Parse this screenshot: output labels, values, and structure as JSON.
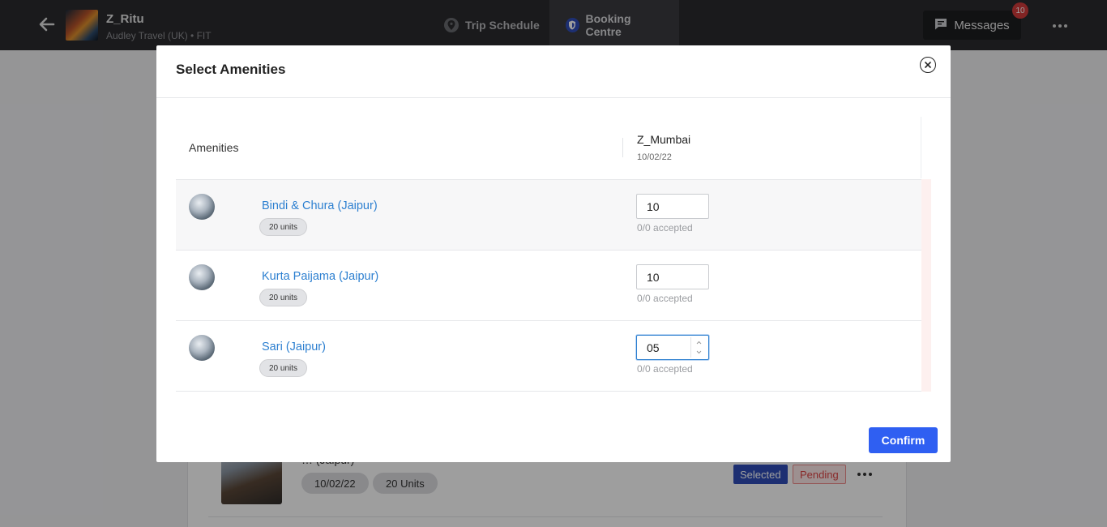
{
  "topbar": {
    "trip_title": "Z_Ritu",
    "trip_subtitle": "Audley Travel (UK) • FIT",
    "tabs": [
      {
        "label": "Trip Schedule",
        "icon": "location-pin-icon"
      },
      {
        "label": "Booking Centre",
        "icon": "shield-icon"
      }
    ],
    "messages_label": "Messages",
    "messages_count": "10"
  },
  "background_card": {
    "title": "… (Jaipur)",
    "date": "10/02/22",
    "units": "20 Units",
    "status_selected": "Selected",
    "status_pending": "Pending"
  },
  "modal": {
    "title": "Select Amenities",
    "column_amenities": "Amenities",
    "hotel_name": "Z_Mumbai",
    "hotel_date": "10/02/22",
    "rows": [
      {
        "name": "Bindi & Chura (Jaipur)",
        "units": "20 units",
        "quantity": "10",
        "accepted": "0/0 accepted"
      },
      {
        "name": "Kurta Paijama (Jaipur)",
        "units": "20 units",
        "quantity": "10",
        "accepted": "0/0 accepted"
      },
      {
        "name": "Sari (Jaipur)",
        "units": "20 units",
        "quantity": "05",
        "accepted": "0/0 accepted"
      }
    ],
    "confirm_label": "Confirm"
  },
  "colors": {
    "topbar": "#2a2b2e",
    "accent_blue": "#2f5ff2",
    "link_blue": "#2c7fd0",
    "badge_red": "#d23b3b"
  }
}
